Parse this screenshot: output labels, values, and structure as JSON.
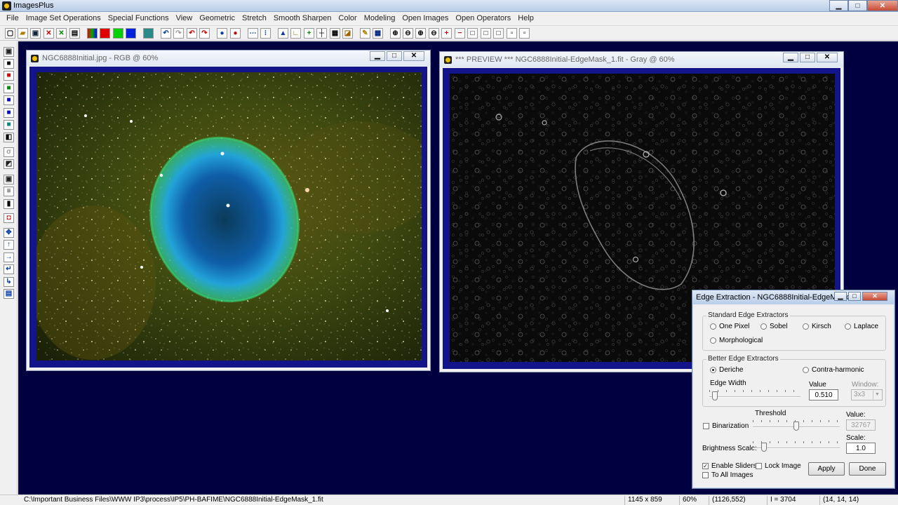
{
  "app": {
    "title": "ImagesPlus"
  },
  "menu": [
    "File",
    "Image Set Operations",
    "Special Functions",
    "View",
    "Geometric",
    "Stretch",
    "Smooth Sharpen",
    "Color",
    "Modeling",
    "Open Images",
    "Open Operators",
    "Help"
  ],
  "windows": {
    "left": {
      "title": "NGC6888Initial.jpg - RGB @ 60%"
    },
    "right": {
      "title": "*** PREVIEW *** NGC6888Initial-EdgeMask_1.fit - Gray @ 60%"
    }
  },
  "dialog": {
    "title": "Edge Extraction - NGC6888Initial-EdgeMask...",
    "standard": {
      "label": "Standard Edge Extractors",
      "options": [
        "One Pixel",
        "Sobel",
        "Kirsch",
        "Laplace",
        "Morphological"
      ]
    },
    "better": {
      "label": "Better Edge Extractors",
      "options": [
        "Deriche",
        "Contra-harmonic"
      ],
      "selected": "Deriche",
      "edge_width_label": "Edge Width",
      "value_label": "Value",
      "value": "0.510",
      "window_label": "Window:",
      "window_value": "3x3",
      "edge_width_level": 0.03
    },
    "binarization": {
      "label": "Binarization",
      "threshold_label": "Threshold",
      "value_label": "Value:",
      "value": "32767",
      "threshold_level": 0.5
    },
    "brightness": {
      "label": "Brightness Scale:",
      "scale_label": "Scale:",
      "value": "1.0",
      "level": 0.1
    },
    "checks": {
      "enable_sliders": "Enable Sliders",
      "lock_image": "Lock Image",
      "to_all_images": "To All Images"
    },
    "check_mark": "✓",
    "apply": "Apply",
    "done": "Done"
  },
  "status": {
    "path": "C:\\Important Business Files\\WWW IP3\\process\\IP5\\PH-BAFIME\\NGC6888Initial-EdgeMask_1.fit",
    "size": "1145 x 859",
    "zoom": "60%",
    "coords": "(1126,552)",
    "intensity": "I = 3704",
    "rgb": "(14, 14, 14)"
  },
  "icons": {
    "minimize": "▁",
    "maximize": "□",
    "close": "✕"
  }
}
